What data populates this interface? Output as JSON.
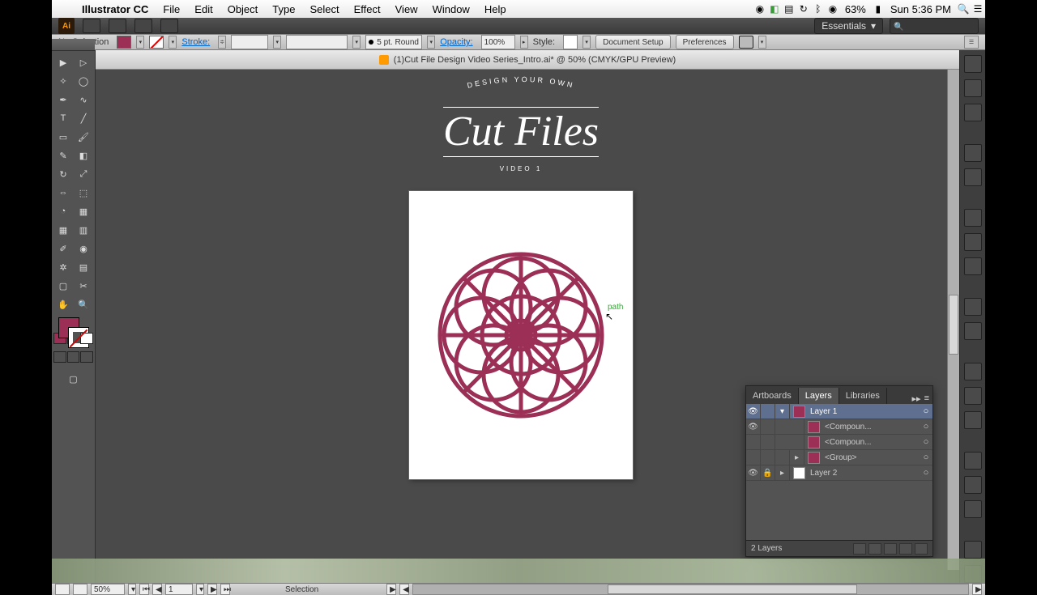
{
  "menubar": {
    "app": "Illustrator CC",
    "items": [
      "File",
      "Edit",
      "Object",
      "Type",
      "Select",
      "Effect",
      "View",
      "Window",
      "Help"
    ],
    "battery": "63%",
    "datetime": "Sun 5:36 PM"
  },
  "titlebar": {
    "workspace": "Essentials"
  },
  "controlbar": {
    "selection": "No Selection",
    "stroke_label": "Stroke:",
    "stroke_weight": "5 pt. Round",
    "opacity_label": "Opacity:",
    "opacity_value": "100%",
    "style_label": "Style:",
    "doc_setup": "Document Setup",
    "preferences": "Preferences"
  },
  "document": {
    "tab_title": "(1)Cut File Design Video Series_Intro.ai* @ 50% (CMYK/GPU Preview)",
    "heading_arc": "DESIGN YOUR OWN",
    "heading_script": "Cut Files",
    "heading_sub": "VIDEO 1",
    "smart_guide": "path"
  },
  "layers": {
    "tabs": [
      "Artboards",
      "Layers",
      "Libraries"
    ],
    "active_tab": "Layers",
    "rows": [
      {
        "name": "Layer 1",
        "depth": 0,
        "thumb": "pink",
        "expanded": true,
        "selected": true,
        "visible": true,
        "locked": false
      },
      {
        "name": "<Compoun...",
        "depth": 1,
        "thumb": "pink",
        "visible": true,
        "locked": false
      },
      {
        "name": "<Compoun...",
        "depth": 1,
        "thumb": "pink",
        "visible": false,
        "locked": false
      },
      {
        "name": "<Group>",
        "depth": 1,
        "thumb": "pink",
        "visible": false,
        "expandable": true,
        "locked": false
      },
      {
        "name": "Layer 2",
        "depth": 0,
        "thumb": "white",
        "expandable": true,
        "visible": true,
        "locked": true
      }
    ],
    "footer": "2 Layers"
  },
  "statusbar": {
    "zoom": "50%",
    "page": "1",
    "tool": "Selection"
  },
  "colors": {
    "accent": "#9b2f55"
  }
}
